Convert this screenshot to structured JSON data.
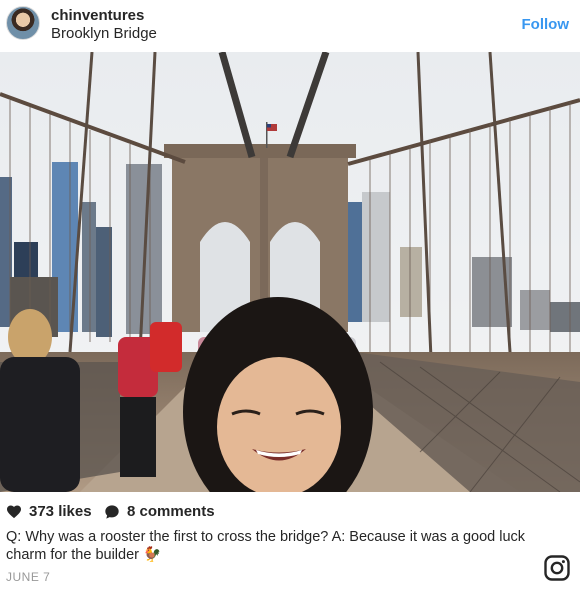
{
  "post": {
    "username": "chinventures",
    "location": "Brooklyn Bridge",
    "follow_label": "Follow",
    "likes": "373 likes",
    "comments": "8 comments",
    "caption": "Q: Why was a rooster the first to cross the bridge? A: Because it was a good luck charm for the builder",
    "caption_emoji": "🐓",
    "date": "JUNE 7"
  },
  "icons": {
    "heart": "heart-icon",
    "comment": "comment-bubble-icon",
    "instagram": "instagram-logo-icon"
  },
  "colors": {
    "link": "#3897f0",
    "text": "#262626",
    "muted": "#999999"
  }
}
